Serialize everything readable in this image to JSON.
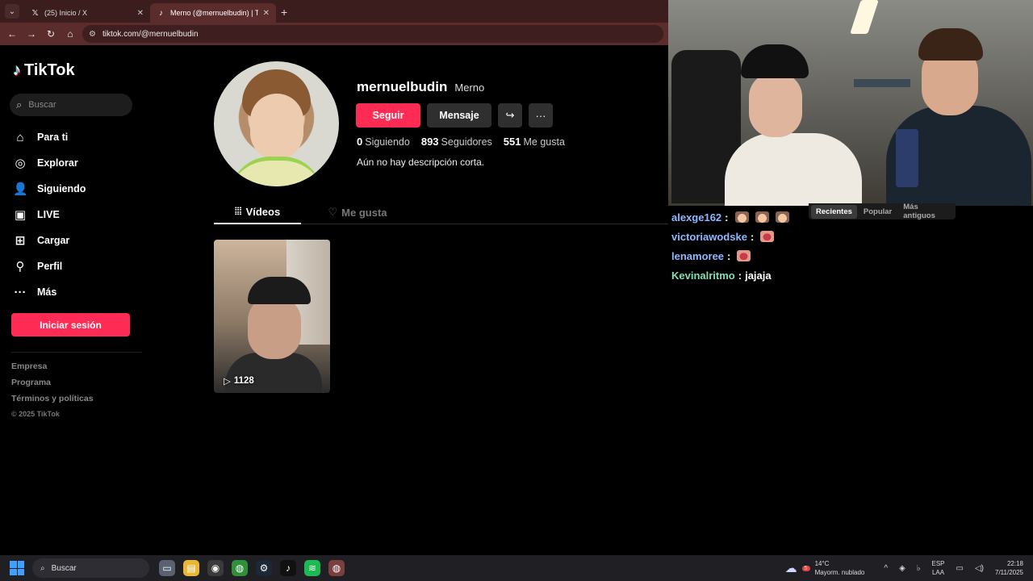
{
  "browser": {
    "tabs": [
      {
        "title": "(25) Inicio / X",
        "icon": "x-logo-icon",
        "active": false
      },
      {
        "title": "Merno (@mernuelbudin) | TikTo",
        "icon": "tiktok-logo-icon",
        "active": true
      }
    ],
    "url": "tiktok.com/@mernuelbudin"
  },
  "sidebar": {
    "logo": "TikTok",
    "search_placeholder": "Buscar",
    "nav": [
      {
        "label": "Para ti",
        "icon": "home-icon"
      },
      {
        "label": "Explorar",
        "icon": "compass-icon"
      },
      {
        "label": "Siguiendo",
        "icon": "user-plus-icon"
      },
      {
        "label": "LIVE",
        "icon": "live-icon"
      },
      {
        "label": "Cargar",
        "icon": "upload-icon"
      },
      {
        "label": "Perfil",
        "icon": "user-icon"
      },
      {
        "label": "Más",
        "icon": "more-icon"
      }
    ],
    "login": "Iniciar sesión",
    "footer": [
      "Empresa",
      "Programa",
      "Términos y políticas"
    ],
    "copyright": "© 2025 TikTok"
  },
  "profile": {
    "username": "mernuelbudin",
    "nickname": "Merno",
    "follow": "Seguir",
    "message": "Mensaje",
    "following_count": "0",
    "following_label": "Siguiendo",
    "followers_count": "893",
    "followers_label": "Seguidores",
    "likes_count": "551",
    "likes_label": "Me gusta",
    "bio": "Aún no hay descripción corta.",
    "tabs": {
      "videos": "Vídeos",
      "liked": "Me gusta"
    },
    "videos": [
      {
        "views": "1128"
      }
    ]
  },
  "chat": {
    "sort_tabs": [
      "Recientes",
      "Popular",
      "Más antiguos"
    ],
    "messages": [
      {
        "user": "alexge162",
        "text": "",
        "emotes": [
          "cat",
          "cat",
          "cat"
        ]
      },
      {
        "user": "victoriawodske",
        "text": "",
        "emotes": [
          "lips"
        ]
      },
      {
        "user": "lenamoree",
        "text": "",
        "emotes": [
          "lips"
        ]
      },
      {
        "user": "Kevinalritmo",
        "text": "jajaja",
        "emotes": []
      }
    ]
  },
  "taskbar": {
    "search": "Buscar",
    "weather_temp": "14°C",
    "weather_desc": "Mayorm. nublado",
    "weather_badge": "5",
    "lang1": "ESP",
    "lang2": "LAA",
    "time": "22:18",
    "date": "7/11/2025"
  },
  "colors": {
    "accent": "#fe2c55",
    "chrome": "#5a2c2c",
    "chat_user": "#8fb8ff"
  }
}
